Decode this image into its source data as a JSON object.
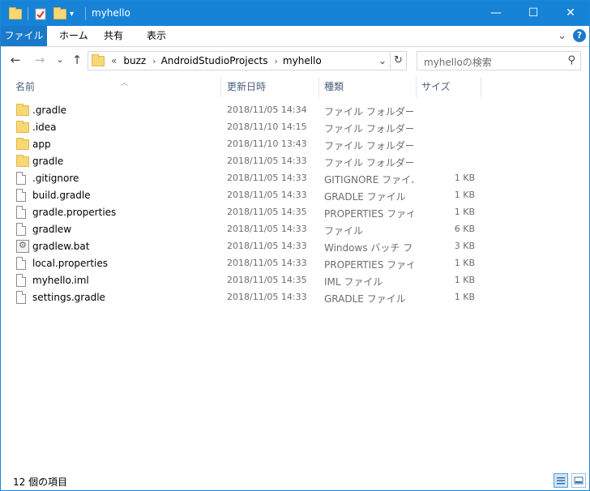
{
  "window": {
    "title": "myhello"
  },
  "titlebar": {
    "min_glyph": "—",
    "max_glyph": "☐",
    "close_glyph": "✕",
    "qa_dropdown_glyph": "▾"
  },
  "ribbon": {
    "tabs": [
      "ファイル",
      "ホーム",
      "共有",
      "表示"
    ],
    "expand_glyph": "⌄",
    "help_glyph": "?"
  },
  "address": {
    "back_glyph": "←",
    "forward_glyph": "→",
    "recent_glyph": "⌄",
    "up_glyph": "↑",
    "overflow": "«",
    "crumbs": [
      "buzz",
      "AndroidStudioProjects",
      "myhello"
    ],
    "crumb_sep": "›",
    "dropdown_glyph": "⌄",
    "refresh_glyph": "↻"
  },
  "search": {
    "placeholder": "myhelloの検索",
    "icon_glyph": "⚲"
  },
  "columns": {
    "name": "名前",
    "date": "更新日時",
    "type": "種類",
    "size": "サイズ",
    "sort_glyph": "︿"
  },
  "files": [
    {
      "name": ".gradle",
      "date": "2018/11/05 14:34",
      "type": "ファイル フォルダー",
      "size": "",
      "icon": "folder-icon"
    },
    {
      "name": ".idea",
      "date": "2018/11/10 14:15",
      "type": "ファイル フォルダー",
      "size": "",
      "icon": "folder-icon"
    },
    {
      "name": "app",
      "date": "2018/11/10 13:43",
      "type": "ファイル フォルダー",
      "size": "",
      "icon": "folder-icon"
    },
    {
      "name": "gradle",
      "date": "2018/11/05 14:33",
      "type": "ファイル フォルダー",
      "size": "",
      "icon": "folder-icon"
    },
    {
      "name": ".gitignore",
      "date": "2018/11/05 14:33",
      "type": "GITIGNORE ファイル",
      "size": "1 KB",
      "icon": "file-icon"
    },
    {
      "name": "build.gradle",
      "date": "2018/11/05 14:33",
      "type": "GRADLE ファイル",
      "size": "1 KB",
      "icon": "file-icon"
    },
    {
      "name": "gradle.properties",
      "date": "2018/11/05 14:35",
      "type": "PROPERTIES ファイル",
      "size": "1 KB",
      "icon": "file-icon"
    },
    {
      "name": "gradlew",
      "date": "2018/11/05 14:33",
      "type": "ファイル",
      "size": "6 KB",
      "icon": "file-icon"
    },
    {
      "name": "gradlew.bat",
      "date": "2018/11/05 14:33",
      "type": "Windows バッチ ファ...",
      "size": "3 KB",
      "icon": "batch-file-icon"
    },
    {
      "name": "local.properties",
      "date": "2018/11/05 14:33",
      "type": "PROPERTIES ファイル",
      "size": "1 KB",
      "icon": "file-icon"
    },
    {
      "name": "myhello.iml",
      "date": "2018/11/05 14:35",
      "type": "IML ファイル",
      "size": "1 KB",
      "icon": "file-icon"
    },
    {
      "name": "settings.gradle",
      "date": "2018/11/05 14:33",
      "type": "GRADLE ファイル",
      "size": "1 KB",
      "icon": "file-icon"
    }
  ],
  "status": {
    "count": "12 個の項目"
  },
  "colors": {
    "titlebar": "#1783d7",
    "file_tab": "#1979ca",
    "folder": "#f8d775"
  }
}
